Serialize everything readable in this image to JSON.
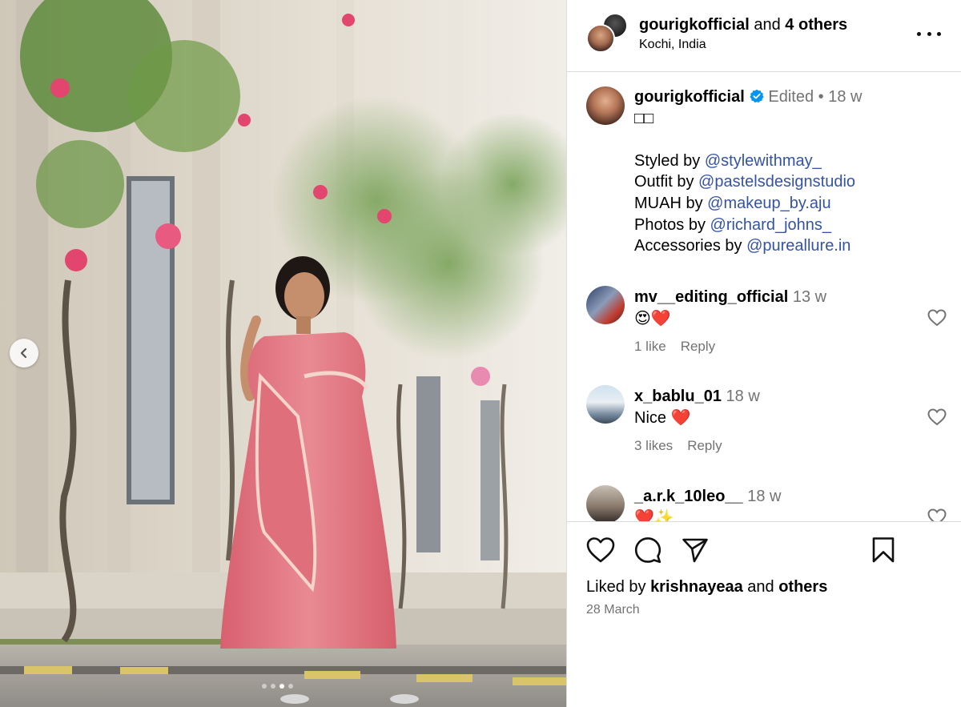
{
  "header": {
    "primary_user": "gourigkofficial",
    "joiner": "and",
    "others": "4 others",
    "location": "Kochi, India"
  },
  "caption": {
    "username": "gourigkofficial",
    "edited": "Edited",
    "separator": "•",
    "time": "18 w",
    "emoji_line": "□□",
    "credits": [
      {
        "label": "Styled by",
        "handle": "@stylewithmay_"
      },
      {
        "label": "Outfit by",
        "handle": "@pastelsdesignstudio"
      },
      {
        "label": "MUAH by",
        "handle": "@makeup_by.aju"
      },
      {
        "label": "Photos by",
        "handle": "@richard_johns_"
      },
      {
        "label": "Accessories by",
        "handle": "@pureallure.in"
      }
    ]
  },
  "comments": [
    {
      "username": "mv__editing_official",
      "time": "13 w",
      "text": "😍❤️",
      "likes": "1 like",
      "reply": "Reply"
    },
    {
      "username": "x_bablu_01",
      "time": "18 w",
      "text": "Nice ❤️",
      "likes": "3 likes",
      "reply": "Reply"
    },
    {
      "username": "_a.r.k_10leo__",
      "time": "18 w",
      "text": "❤️✨"
    }
  ],
  "footer": {
    "liked_by_prefix": "Liked by",
    "liked_by_user": "krishnayeaa",
    "and_word": "and",
    "others_word": "others",
    "date": "28 March"
  },
  "icons": {
    "like": "heart-icon",
    "comment": "comment-bubble-icon",
    "share": "paper-plane-icon",
    "save": "bookmark-icon",
    "verified": "verified-badge-icon",
    "prev": "chevron-left-icon",
    "more": "more-options-icon"
  },
  "carousel": {
    "total_slides": 4,
    "active_slide": 3
  },
  "colors": {
    "link": "#3553a5",
    "verified": "#0095f6",
    "muted": "#737373",
    "heart": "#e0245e"
  }
}
